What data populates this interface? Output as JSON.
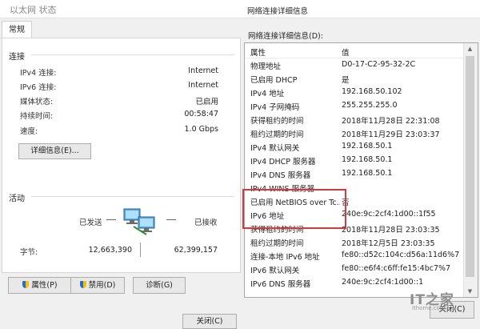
{
  "status_window": {
    "title": "以太网 状态",
    "tab": "常规",
    "connection": {
      "heading": "连接",
      "rows": [
        {
          "label": "IPv4 连接:",
          "value": "Internet"
        },
        {
          "label": "IPv6 连接:",
          "value": "Internet"
        },
        {
          "label": "媒体状态:",
          "value": "已启用"
        },
        {
          "label": "持续时间:",
          "value": "00:58:47"
        },
        {
          "label": "速度:",
          "value": "1.0 Gbps"
        }
      ],
      "details_button": "详细信息(E)..."
    },
    "activity": {
      "heading": "活动",
      "sent_label": "已发送",
      "received_label": "已接收",
      "bytes_label": "字节:",
      "bytes_sent": "12,663,390",
      "bytes_received": "62,399,157"
    },
    "buttons": {
      "properties": "属性(P)",
      "disable": "禁用(D)",
      "diagnose": "诊断(G)"
    },
    "close": "关闭(C)"
  },
  "details_window": {
    "title": "网络连接详细信息",
    "list_label": "网络连接详细信息(D):",
    "col_property": "属性",
    "col_value": "值",
    "rows": [
      {
        "p": "物理地址",
        "v": "D0-17-C2-95-32-2C"
      },
      {
        "p": "已启用 DHCP",
        "v": "是"
      },
      {
        "p": "IPv4 地址",
        "v": "192.168.50.102"
      },
      {
        "p": "IPv4 子网掩码",
        "v": "255.255.255.0"
      },
      {
        "p": "获得租约的时间",
        "v": "2018年11月28日 22:31:08"
      },
      {
        "p": "租约过期的时间",
        "v": "2018年11月29日 23:03:37"
      },
      {
        "p": "IPv4 默认网关",
        "v": "192.168.50.1"
      },
      {
        "p": "IPv4 DHCP 服务器",
        "v": "192.168.50.1"
      },
      {
        "p": "IPv4 DNS 服务器",
        "v": "192.168.50.1"
      },
      {
        "p": "IPv4 WINS 服务器",
        "v": ""
      },
      {
        "p": "已启用 NetBIOS over Tc...",
        "v": "否"
      },
      {
        "p": "IPv6 地址",
        "v": "240e:9c:2cf4:1d00::1f55"
      },
      {
        "p": "获得租约的时间",
        "v": "2018年11月28日 23:03:35"
      },
      {
        "p": "租约过期的时间",
        "v": "2018年12月5日 23:03:35"
      },
      {
        "p": "连接-本地 IPv6 地址",
        "v": "fe80::d52c:104c:d56a:11d6%7"
      },
      {
        "p": "IPv6 默认网关",
        "v": "fe80::e6f4:c6ff:fe15:4bc7%7"
      },
      {
        "p": "IPv6 DNS 服务器",
        "v": "240e:9c:2cf4:1d00::1"
      }
    ],
    "close": "关闭(C)"
  },
  "watermark": {
    "brand": "IT之家",
    "url": "ithome.com"
  },
  "colors": {
    "highlight": "#d13b3b"
  }
}
